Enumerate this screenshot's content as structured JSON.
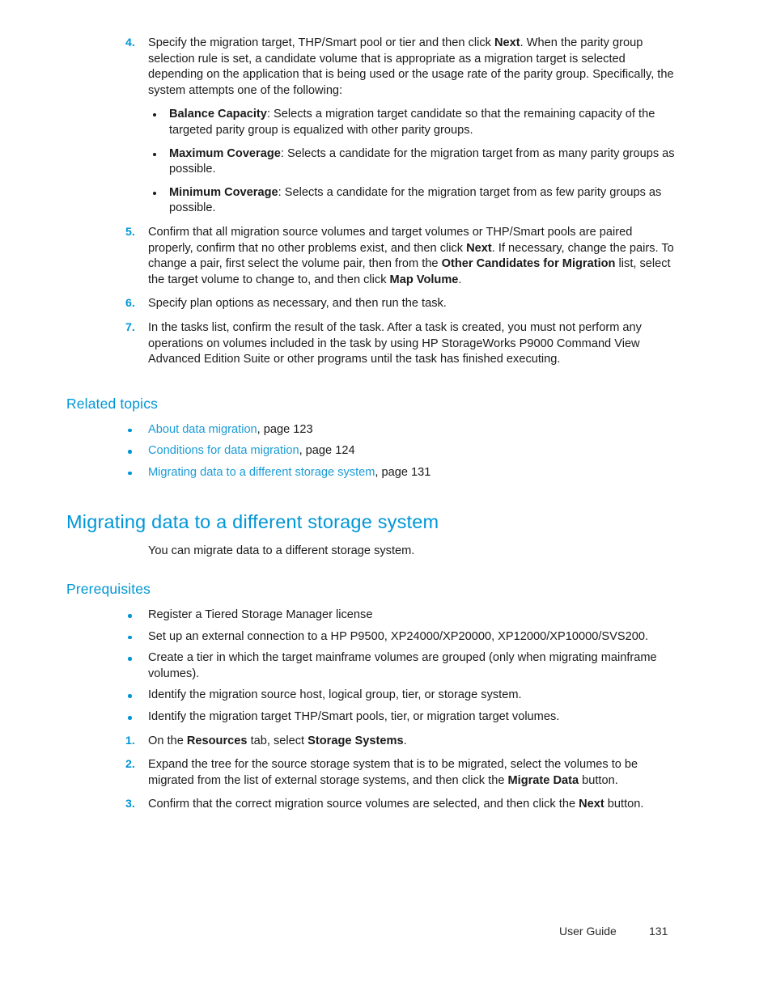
{
  "document": {
    "footer": {
      "label": "User Guide",
      "page_number": "131"
    }
  },
  "steps_top": [
    {
      "number": "4.",
      "text_before": "Specify the migration target, THP/Smart pool or tier and then click ",
      "bold1": "Next",
      "text_after": ". When the parity group selection rule is set, a candidate volume that is appropriate as a migration target is selected depending on the application that is being used or the usage rate of the parity group. Specifically, the system attempts one of the following:",
      "sublist": [
        {
          "bold": "Balance Capacity",
          "text": ": Selects a migration target candidate so that the remaining capacity of the targeted parity group is equalized with other parity groups."
        },
        {
          "bold": "Maximum Coverage",
          "text": ": Selects a candidate for the migration target from as many parity groups as possible."
        },
        {
          "bold": "Minimum Coverage",
          "text": ": Selects a candidate for the migration target from as few parity groups as possible."
        }
      ]
    },
    {
      "number": "5.",
      "seg1": "Confirm that all migration source volumes and target volumes or THP/Smart pools are paired properly, confirm that no other problems exist, and then click ",
      "bold1": "Next",
      "seg2": ". If necessary, change the pairs. To change a pair, first select the volume pair, then from the ",
      "bold2": "Other Candidates for Migration",
      "seg3": " list, select the target volume to change to, and then click ",
      "bold3": "Map Volume",
      "seg4": "."
    },
    {
      "number": "6.",
      "seg1": "Specify plan options as necessary, and then run the task."
    },
    {
      "number": "7.",
      "seg1": "In the tasks list, confirm the result of the task. After a task is created, you must not perform any operations on volumes included in the task by using HP StorageWorks P9000 Command View Advanced Edition Suite or other programs until the task has finished executing."
    }
  ],
  "related_topics": {
    "heading": "Related topics",
    "items": [
      {
        "link": "About data migration",
        "suffix": ", page 123"
      },
      {
        "link": "Conditions for data migration",
        "suffix": ", page 124"
      },
      {
        "link": "Migrating data to a different storage system",
        "suffix": ", page 131"
      }
    ]
  },
  "topic": {
    "heading": "Migrating data to a different storage system",
    "intro": "You can migrate data to a different storage system."
  },
  "prerequisites": {
    "heading": "Prerequisites",
    "items": [
      "Register a Tiered Storage Manager license",
      "Set up an external connection to a HP P9500, XP24000/XP20000, XP12000/XP10000/SVS200.",
      "Create a tier in which the target mainframe volumes are grouped (only when migrating mainframe volumes).",
      "Identify the migration source host, logical group, tier, or storage system.",
      "Identify the migration target THP/Smart pools, tier, or migration target volumes."
    ]
  },
  "steps_bottom": [
    {
      "number": "1.",
      "seg1": "On the ",
      "bold1": "Resources",
      "seg2": " tab, select ",
      "bold2": "Storage Systems",
      "seg3": "."
    },
    {
      "number": "2.",
      "seg1": "Expand the tree for the source storage system that is to be migrated, select the volumes to be migrated from the list of external storage systems, and then click the ",
      "bold1": "Migrate Data",
      "seg2": " button."
    },
    {
      "number": "3.",
      "seg1": "Confirm that the correct migration source volumes are selected, and then click the ",
      "bold1": "Next",
      "seg2": " button."
    }
  ],
  "colors": {
    "accent_blue": "#0096d6",
    "link_blue": "#1a9bd7",
    "body_text": "#1a1a1a"
  }
}
